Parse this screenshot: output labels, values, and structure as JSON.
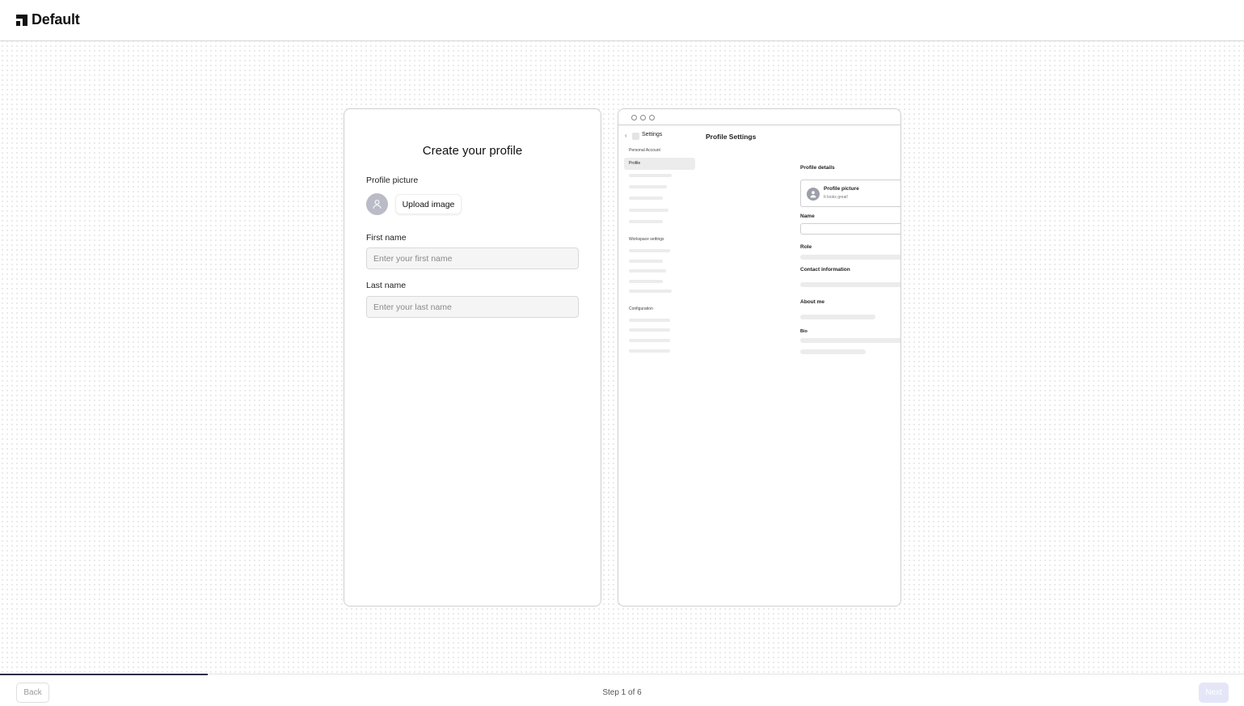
{
  "header": {
    "brand": "Default"
  },
  "form": {
    "title": "Create your profile",
    "picture_label": "Profile picture",
    "upload_label": "Upload image",
    "first_name_label": "First name",
    "first_name_placeholder": "Enter your first name",
    "first_name_value": "",
    "last_name_label": "Last name",
    "last_name_placeholder": "Enter your last name",
    "last_name_value": ""
  },
  "preview": {
    "back_glyph": "‹",
    "settings_title": "Settings",
    "page_title": "Profile Settings",
    "section_personal": "Personal Account",
    "nav_profile": "Profile",
    "section_workspace": "Workspace settings",
    "section_configuration": "Configuration",
    "details_title": "Profile details",
    "picture_title": "Profile picture",
    "picture_subtitle": "It looks great!",
    "name_label": "Name",
    "role_label": "Role",
    "contact_label": "Contact information",
    "about_label": "About me",
    "bio_label": "Bio"
  },
  "footer": {
    "back_label": "Back",
    "step_text": "Step 1 of 6",
    "next_label": "Next",
    "step_current": 1,
    "step_total": 6
  },
  "colors": {
    "progress": "#2b2f45",
    "next_button_disabled": "#e4e6f8",
    "avatar": "#b9bcc6"
  }
}
